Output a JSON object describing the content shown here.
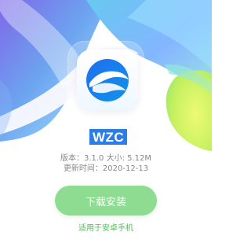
{
  "app": {
    "name": "WZC",
    "version_line": "版本：3.1.0 大小: 5.12M",
    "update_line": "更新时间：2020-12-13",
    "download_label": "下载安装",
    "compat_text": "适用于安卓手机",
    "icon_name": "app-logo-icon"
  },
  "colors": {
    "name_highlight": "#2d7de8",
    "button": "#8edc91",
    "compat_text": "#4fbe58",
    "meta_text": "#888888"
  }
}
